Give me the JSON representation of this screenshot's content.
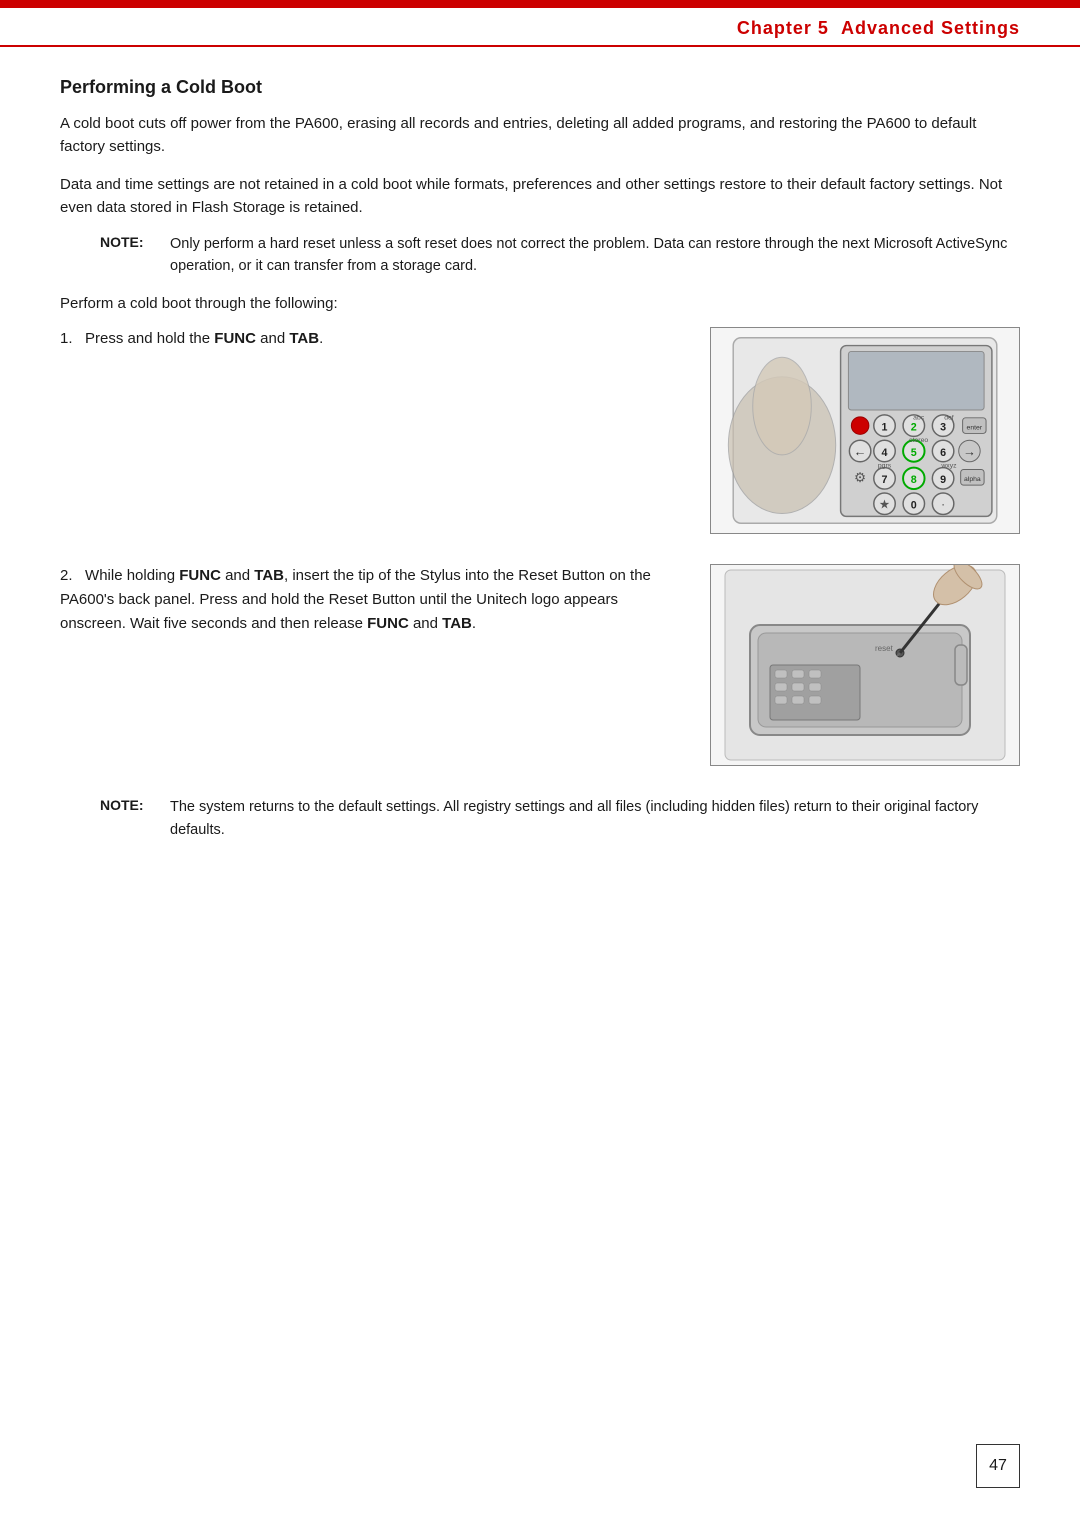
{
  "header": {
    "bar_color": "#cc0000",
    "chapter_label": "Chapter 5",
    "chapter_title": "Advanced Settings"
  },
  "section": {
    "title": "Performing a Cold Boot",
    "para1": "A cold boot cuts off power from the PA600, erasing all records and entries, deleting all added programs, and restoring the PA600 to default factory settings.",
    "para2": "Data and time settings are not retained in a cold boot while formats, preferences and other settings restore to their default factory settings. Not even data stored in Flash Storage is retained.",
    "note1_label": "NOTE:",
    "note1_text": "Only perform a hard reset unless a soft reset does not correct the problem. Data can restore through the next Microsoft ActiveSync operation, or it can transfer from a storage card.",
    "perform_para": "Perform a cold boot through the following:",
    "step1_num": "1.",
    "step1_text_prefix": "Press and hold the ",
    "step1_func": "FUNC",
    "step1_and": " and ",
    "step1_tab": "TAB",
    "step1_suffix": ".",
    "step2_num": "2.",
    "step2_text_p1": "While holding ",
    "step2_func": "FUNC",
    "step2_and1": " and ",
    "step2_tab": "TAB",
    "step2_text_p2": ", insert the tip of the Stylus into the Reset Button on the PA600’s back panel. Press and hold the Reset Button until the Unitech logo appears onscreen. Wait five seconds and then release ",
    "step2_func2": "FUNC",
    "step2_and2": " and ",
    "step2_tab2": "TAB",
    "step2_suffix": ".",
    "note2_label": "NOTE:",
    "note2_text": "The system returns to the default settings. All registry settings and all files (including hidden files) return to their original factory defaults.",
    "page_number": "47"
  },
  "keypad": {
    "keys": [
      "1",
      "2",
      "3",
      "4",
      "5",
      "6",
      "7",
      "8",
      "9",
      "0"
    ],
    "accent_color": "#cc0000",
    "highlight_keys": [
      "5",
      "8"
    ]
  }
}
